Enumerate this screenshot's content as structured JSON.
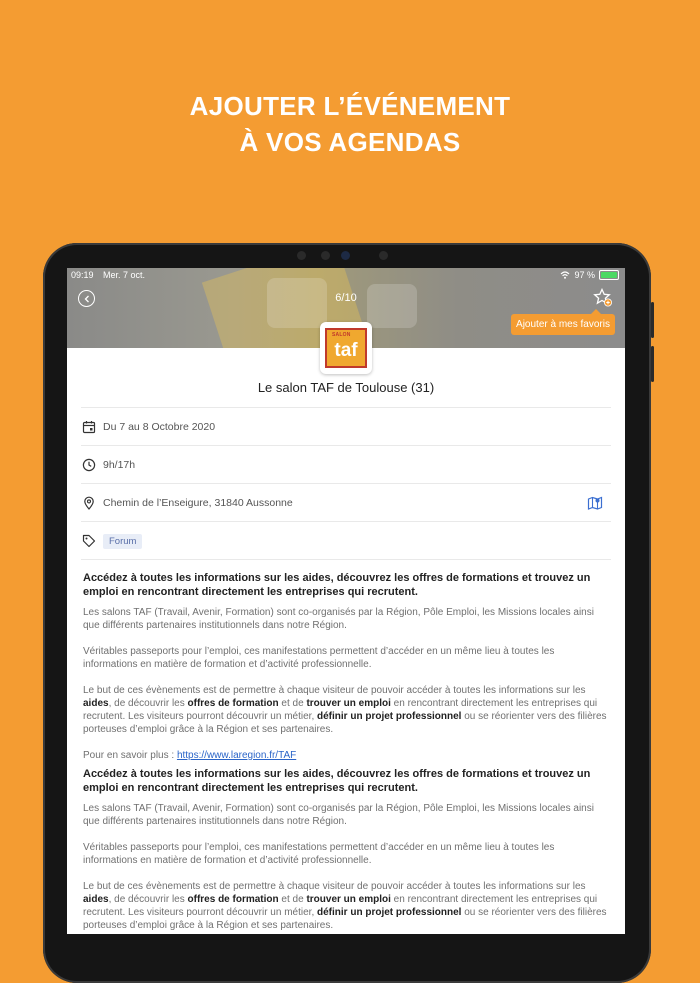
{
  "headline": {
    "line1": "AJOUTER L’ÉVÉNEMENT",
    "line2": "À VOS AGENDAS"
  },
  "status_bar": {
    "time": "09:19",
    "date": "Mer. 7 oct.",
    "battery": "97 %",
    "battery_level": 0.97
  },
  "nav": {
    "counter": "6/10",
    "favorite_tooltip": "Ajouter à mes favoris"
  },
  "logo": {
    "text": "taf",
    "tag": "SALON"
  },
  "event": {
    "title": "Le salon TAF de Toulouse (31)",
    "date": "Du 7 au 8 Octobre 2020",
    "hours": "9h/17h",
    "address": "Chemin de l’Enseigure, 31840 Aussonne",
    "tag": "Forum"
  },
  "description": {
    "lead": "Accédez à toutes les informations sur les aides, découvrez les offres de formations et trouvez un emploi en rencontrant directement les entreprises qui recrutent.",
    "p1": "Les salons TAF (Travail, Avenir, Formation) sont co-organisés par la Région, Pôle Emploi, les Missions locales ainsi que différents partenaires institutionnels dans notre Région.",
    "p2": "Véritables passeports pour l’emploi, ces manifestations permettent d’accéder en un même lieu à toutes les informations en matière de formation et d’activité professionnelle.",
    "p3_a": "Le but de ces évènements est de permettre à chaque visiteur de pouvoir accéder à toutes les informations sur les ",
    "p3_b": "aides",
    "p3_c": ", de découvrir les ",
    "p3_d": "offres de formation",
    "p3_e": " et de ",
    "p3_f": "trouver un emploi",
    "p3_g": " en rencontrant directement les entreprises qui recrutent. Les visiteurs pourront découvrir un métier, ",
    "p3_h": "définir un projet professionnel",
    "p3_i": " ou se réorienter vers des filières porteuses d’emploi grâce à la Région et ses partenaires.",
    "learn_more": "Pour en savoir plus : ",
    "link": "https://www.laregion.fr/TAF"
  },
  "colors": {
    "brand_orange": "#F49C32",
    "link_blue": "#2a64c8",
    "tag_bg": "#e8edf7"
  }
}
